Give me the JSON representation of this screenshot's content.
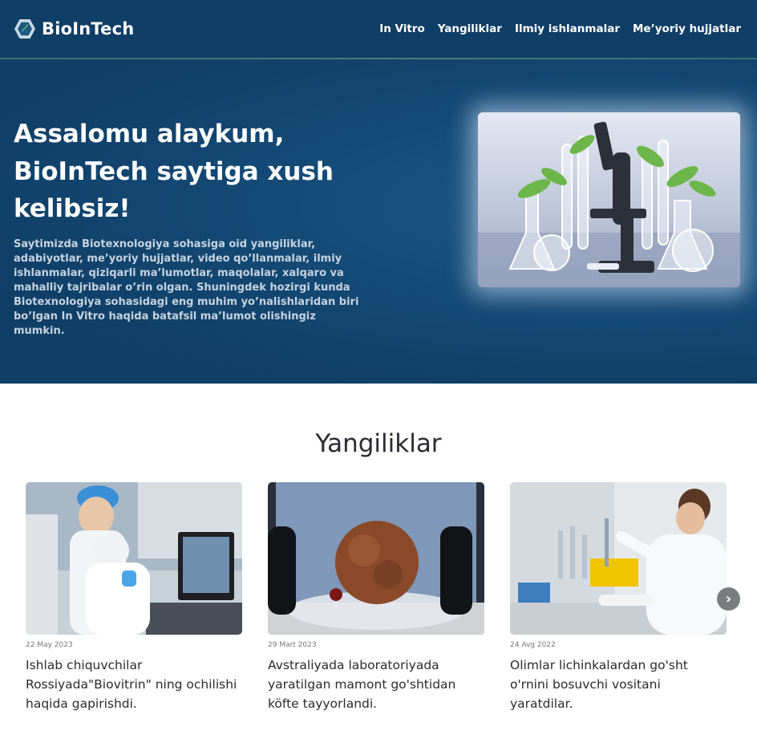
{
  "brand": {
    "name": "BioInTech"
  },
  "nav": {
    "items": [
      "In Vitro",
      "Yangiliklar",
      "Ilmiy ishlanmalar",
      "Me’yoriy hujjatlar"
    ]
  },
  "hero": {
    "title": "Assalomu alaykum, BioInTech saytiga xush kelibsiz!",
    "text": "Saytimizda Biotexnologiya sohasiga oid yangiliklar, adabiyotlar, me’yoriy hujjatlar, video qo’llanmalar, ilmiy ishlanmalar, qiziqarli ma’lumotlar, maqolalar, xalqaro va mahalliy tajribalar o’rin olgan. Shuningdek hozirgi kunda Biotexnologiya sohasidagi eng muhim yo’nalishlaridan biri bo’lgan In Vitro haqida batafsil ma’lumot olishingiz mumkin."
  },
  "news": {
    "heading": "Yangiliklar",
    "items": [
      {
        "date": "22 May 2023",
        "title": "Ishlab chiquvchilar Rossiyada\"Biovitrin\" ning ochilishi haqida gapirishdi."
      },
      {
        "date": "29 Mart 2023",
        "title": "Avstraliyada laboratoriyada yaratilgan mamont go'shtidan köfte tayyorlandi."
      },
      {
        "date": "24 Avg 2022",
        "title": "Olimlar lichinkalardan go'sht o'rnini bosuvchi vositani yaratdilar."
      }
    ],
    "next_icon": "›"
  },
  "colors": {
    "header_bg": "#0f3e66",
    "hero_bg": "#144a76",
    "accent_line": "#4a7d76"
  }
}
